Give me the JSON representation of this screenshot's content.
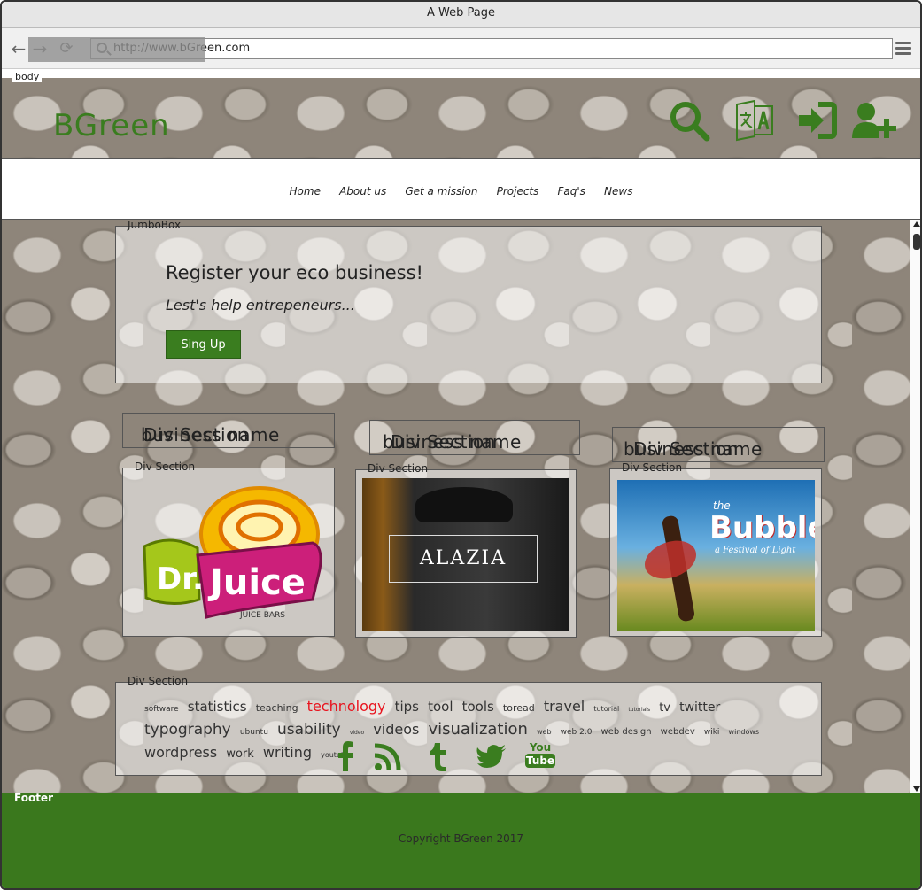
{
  "browser": {
    "title": "A Web Page",
    "url": "http://www.bGreen.com"
  },
  "body_label": "body",
  "header": {
    "logo": "BGreen",
    "icons": [
      "search-icon",
      "translate-icon",
      "login-icon",
      "add-user-icon"
    ]
  },
  "menu": {
    "items": [
      "Home",
      "About us",
      "Get a mission",
      "Projects",
      "Faq's",
      "News"
    ]
  },
  "jumbo": {
    "legend": "JumboBox",
    "headline": "Register your eco business!",
    "subline": "Lest's help entrepeneurs...",
    "button": "Sing Up"
  },
  "businesses": [
    {
      "name_legend": "Div Section",
      "name": "business name",
      "card_legend": "Div Section",
      "image_text": "Dr.Juice",
      "image_sub": "JUICE BARS"
    },
    {
      "name_legend": "Div Section",
      "name": "business name",
      "card_legend": "Div Section",
      "image_text": "ALAZIA"
    },
    {
      "name_legend": "Div Section",
      "name": "business name",
      "card_legend": "Div Section",
      "image_text": "the Bubble",
      "image_sub": "a Festival of Light"
    }
  ],
  "tags": {
    "legend": "Div Section",
    "items": [
      "software",
      "statistics",
      "teaching",
      "technology",
      "tips",
      "tool",
      "tools",
      "toread",
      "travel",
      "tutorial",
      "tutorials",
      "tv",
      "twitter",
      "typography",
      "ubuntu",
      "usability",
      "video",
      "videos",
      "visualization",
      "web",
      "web 2.0",
      "web design",
      "webdev",
      "wiki",
      "windows",
      "wordpress",
      "work",
      "writing",
      "youtube"
    ],
    "social": [
      "facebook-icon",
      "rss-icon",
      "tumblr-icon",
      "twitter-icon",
      "youtube-icon"
    ],
    "youtube_text": [
      "You",
      "Tube"
    ]
  },
  "footer": {
    "label": "Footer",
    "copyright": "Copyright BGreen 2017"
  },
  "colors": {
    "brand_green": "#3a7d1f",
    "footer_green": "#3a781d",
    "highlight_tag": "#e8141e"
  }
}
